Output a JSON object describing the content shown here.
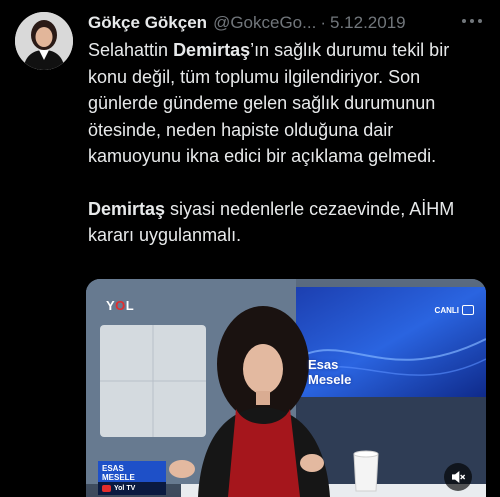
{
  "tweet": {
    "author_name": "Gökçe Gökçen",
    "handle": "@GokceGo...",
    "separator": "·",
    "date": "5.12.2019",
    "paragraph1": {
      "pre": "Selahattin ",
      "bold": "Demirtaş",
      "post": "’ın sağlık durumu tekil bir konu değil, tüm toplumu ilgilendiriyor. Son günlerde gündeme gelen sağlık durumunun ötesinde, neden hapiste olduğuna dair kamuoyunu ikna edici bir açıklama gelmedi."
    },
    "paragraph2": {
      "bold": "Demirtaş",
      "post": " siyasi nedenlerle cezaevinde, AİHM kararı uygulanmalı."
    }
  },
  "media": {
    "logo_pre": "Y",
    "logo_o": "O",
    "logo_post": "L",
    "live_label": "CANLI",
    "screen_title_line1": "Esas",
    "screen_title_line2": "Mesele",
    "lower_third_line1": "ESAS",
    "lower_third_line2": "MESELE",
    "channel_label": "Yol TV"
  },
  "icons": {
    "more": "more-horizontal-icon",
    "mute": "volume-muted-icon"
  },
  "colors": {
    "background": "#000000",
    "text_primary": "#e7e9ea",
    "text_secondary": "#71767b",
    "accent_red": "#e32d2d",
    "lower_third_blue": "#1e50c8"
  }
}
